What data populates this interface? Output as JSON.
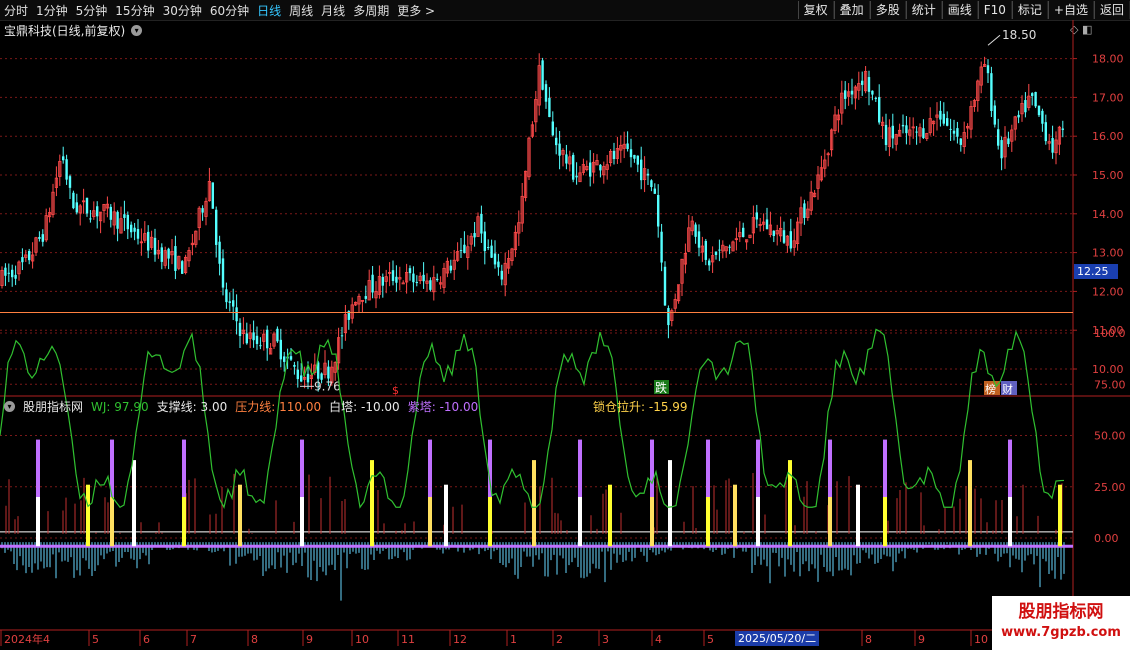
{
  "toolbar": {
    "periods": [
      "分时",
      "1分钟",
      "5分钟",
      "15分钟",
      "30分钟",
      "60分钟",
      "日线",
      "周线",
      "月线",
      "多周期",
      "更多 >"
    ],
    "active_period": "日线",
    "actions": [
      "复权",
      "叠加",
      "多股",
      "统计",
      "画线",
      "F10",
      "标记",
      "+自选",
      "返回"
    ]
  },
  "chart_title": "宝鼎科技(日线,前复权)",
  "price_axis": {
    "ticks": [
      "18.00",
      "17.00",
      "16.00",
      "15.00",
      "14.00",
      "13.00",
      "12.00",
      "11.00",
      "10.00"
    ],
    "current": "12.25"
  },
  "annotations": {
    "high": "18.50",
    "low": "9.76",
    "signal_die": "跌",
    "badges": [
      "榜",
      "财"
    ]
  },
  "indicator": {
    "name": "股朋指标网",
    "wj_label": "WJ:",
    "wj_value": "97.90",
    "support_label": "支撑线:",
    "support_value": "3.00",
    "pressure_label": "压力线:",
    "pressure_value": "110.00",
    "white_label": "白塔:",
    "white_value": "-10.00",
    "purple_label": "紫塔:",
    "purple_value": "-10.00",
    "lock_label": "锁仓拉升:",
    "lock_value": "-15.99",
    "axis": [
      "100.0",
      "75.00",
      "50.00",
      "25.00",
      "0.00"
    ]
  },
  "date_axis": {
    "labels": [
      "2024年4",
      "5",
      "6",
      "7",
      "8",
      "9",
      "10",
      "11",
      "12",
      "1",
      "2",
      "3",
      "4",
      "5",
      "8",
      "9",
      "10"
    ],
    "cursor_date": "2025/05/20/二"
  },
  "watermark": {
    "line1": "股朋指标网",
    "line2": "www.7gpzb.com"
  },
  "colors": {
    "up": "#ff4a4a",
    "down": "#54ffff",
    "pressure": "#ff8040",
    "wj": "#30c030",
    "purple": "#c070ff",
    "yellow": "#ffff30",
    "accent": "#35c7ff"
  },
  "chart_data": {
    "type": "candlestick",
    "series": [
      {
        "name": "WJ"
      }
    ],
    "price_range": [
      9.5,
      18.5
    ],
    "indicator_range": [
      -30,
      120
    ],
    "high_point": 18.5,
    "low_point": 9.76,
    "last_price": 12.25
  }
}
